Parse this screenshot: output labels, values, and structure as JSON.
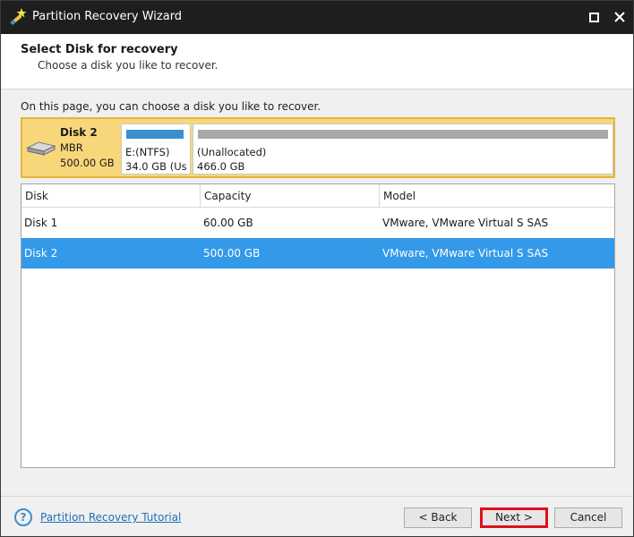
{
  "window": {
    "title": "Partition Recovery Wizard",
    "icon": "wizard-wand-icon"
  },
  "header": {
    "title": "Select Disk for recovery",
    "subtitle": "Choose a disk you like to recover."
  },
  "intro_text": "On this page, you can choose a disk you like to recover.",
  "disk_map": {
    "name": "Disk 2",
    "type": "MBR",
    "size": "500.00 GB",
    "partitions": [
      {
        "label": "E:(NTFS)",
        "size": "34.0 GB (Us",
        "bar_color": "#3a8fd0"
      },
      {
        "label": "(Unallocated)",
        "size": "466.0 GB",
        "bar_color": "#a8a8a8"
      }
    ]
  },
  "table": {
    "columns": [
      "Disk",
      "Capacity",
      "Model"
    ],
    "rows": [
      {
        "disk": "Disk 1",
        "capacity": "60.00 GB",
        "model": "VMware, VMware Virtual S SAS",
        "selected": false
      },
      {
        "disk": "Disk 2",
        "capacity": "500.00 GB",
        "model": "VMware, VMware Virtual S SAS",
        "selected": true
      }
    ]
  },
  "footer": {
    "help_link": "Partition Recovery Tutorial",
    "back_label": "< Back",
    "next_label": "Next >",
    "cancel_label": "Cancel"
  },
  "colors": {
    "selection": "#3399e8",
    "disk_highlight": "#f7d77a",
    "next_outline": "#e0101a"
  }
}
